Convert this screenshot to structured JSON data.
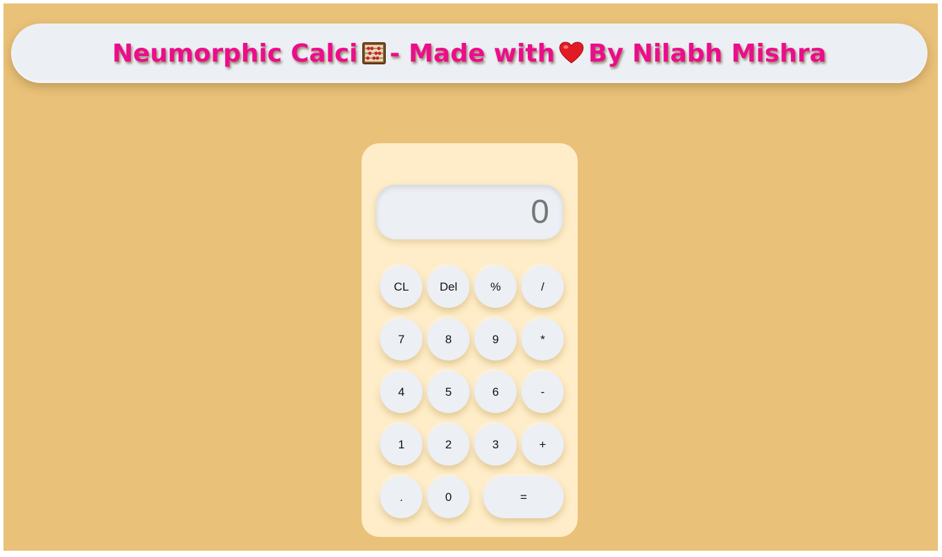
{
  "header": {
    "title_part1": "Neumorphic Calci",
    "title_part2": "- Made with",
    "title_part3": "By Nilabh Mishra",
    "abacus_icon": "abacus-icon",
    "heart_icon": "heart-icon"
  },
  "colors": {
    "background": "#e9c178",
    "title": "#ec0d8a",
    "panel": "#feedc8",
    "key": "#eceff4",
    "display_text": "#777777"
  },
  "display": {
    "value": "0"
  },
  "keys": {
    "clear": "CL",
    "delete": "Del",
    "percent": "%",
    "divide": "/",
    "seven": "7",
    "eight": "8",
    "nine": "9",
    "multiply": "*",
    "four": "4",
    "five": "5",
    "six": "6",
    "minus": "-",
    "one": "1",
    "two": "2",
    "three": "3",
    "plus": "+",
    "dot": ".",
    "zero": "0",
    "equals": "="
  }
}
